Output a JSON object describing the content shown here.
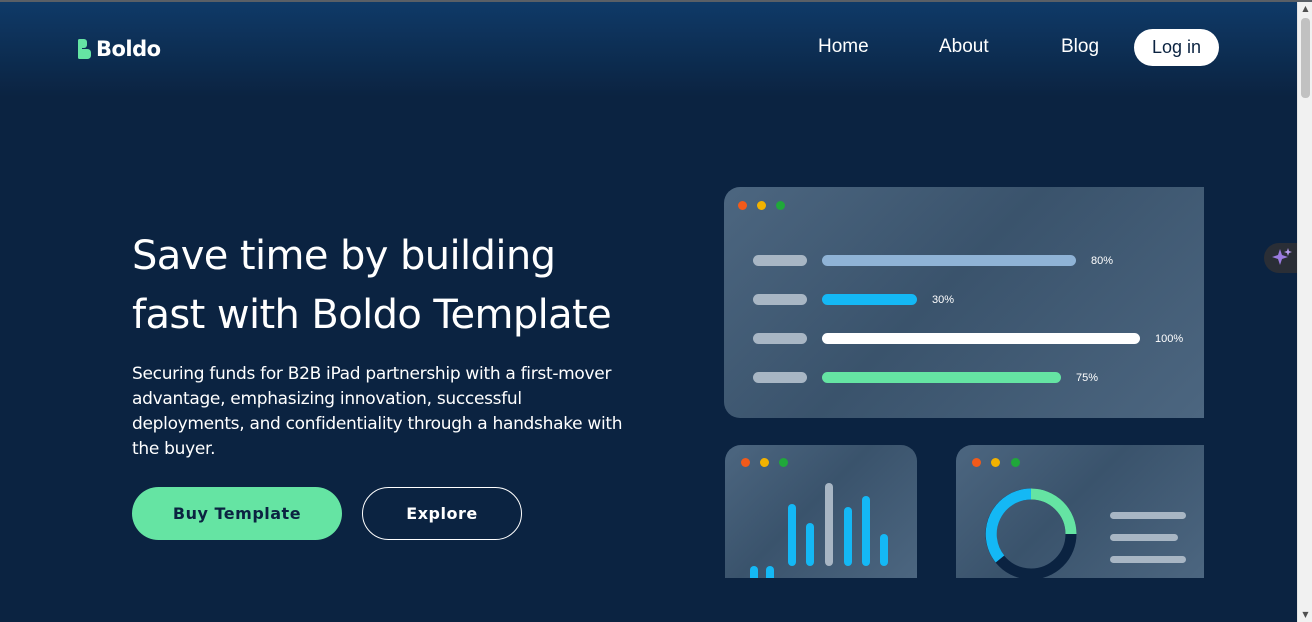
{
  "nav": {
    "brand": "Boldo",
    "links": [
      "Home",
      "About",
      "Blog"
    ],
    "login_label": "Log in"
  },
  "hero": {
    "title_line1": "Save time by building",
    "title_line2": "fast with Boldo Template",
    "description": "Securing funds for B2B iPad partnership with a first-mover advantage, emphasizing innovation, successful deployments, and confidentiality through a handshake with the buyer.",
    "buy_label": "Buy Template",
    "explore_label": "Explore"
  },
  "illustration": {
    "progress_rows": [
      {
        "percent": 80,
        "label": "80%",
        "color": "#8fb3d6"
      },
      {
        "percent": 30,
        "label": "30%",
        "color": "#14b8f5"
      },
      {
        "percent": 100,
        "label": "100%",
        "color": "#ffffff"
      },
      {
        "percent": 75,
        "label": "75%",
        "color": "#65e4a3"
      }
    ],
    "window_dots": [
      "#f25a1a",
      "#f2b200",
      "#20a83a"
    ]
  },
  "colors": {
    "background": "#0b2341",
    "accent": "#65e4a3",
    "blue_accent": "#14b8f5"
  },
  "icons": {
    "logo": "boldo-logo-icon",
    "assistant": "sparkle-icon"
  }
}
